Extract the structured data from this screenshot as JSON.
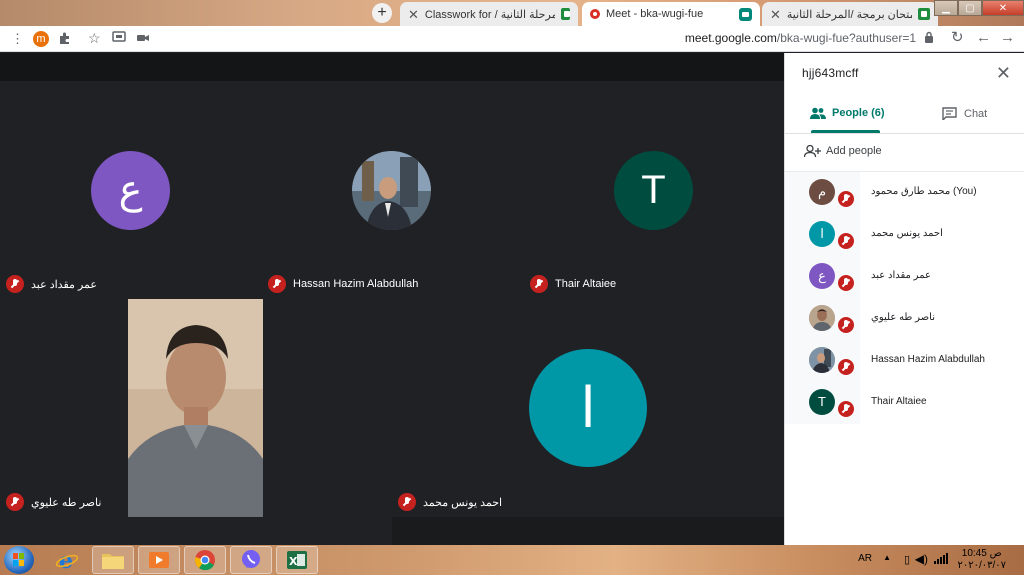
{
  "browser": {
    "tabs": [
      {
        "title": "امتحان برمجة /المرحلة الثانية /"
      },
      {
        "title": "Meet - bka-wugi-fue"
      },
      {
        "title": "Classwork for / برمجة /المرحلة الثانية"
      }
    ],
    "profile_initial": "m",
    "url_host": "meet.google.com",
    "url_path": "/bka-wugi-fue?authuser=1"
  },
  "stage": {
    "tiles": [
      {
        "name": "عمر مقداد عبد",
        "avatar_letter": "ع",
        "avatar_color": "#7e57c2"
      },
      {
        "name": "Hassan Hazim Alabdullah"
      },
      {
        "name": "Thair Altaiee",
        "avatar_letter": "T",
        "avatar_color": "#004d40"
      },
      {
        "name": "ناصر طه عليوي"
      },
      {
        "name": "احمد يونس محمد",
        "avatar_letter": "ا",
        "avatar_color": "#0097a7"
      }
    ]
  },
  "panel": {
    "meeting_code": "hjj643mcff",
    "tab_people": "People (6)",
    "tab_chat": "Chat",
    "add_people": "Add people",
    "participants": [
      {
        "name": "محمد طارق محمود (You)",
        "avatar_letter": "م",
        "avatar_color": "#6d4c41"
      },
      {
        "name": "احمد يونس محمد",
        "avatar_letter": "ا",
        "avatar_color": "#0097a7"
      },
      {
        "name": "عمر مقداد عبد",
        "avatar_letter": "ع",
        "avatar_color": "#7e57c2"
      },
      {
        "name": "ناصر طه عليوي",
        "avatar_letter": "",
        "avatar_color": "#9e9e9e"
      },
      {
        "name": "Hassan Hazim Alabdullah",
        "avatar_letter": "",
        "avatar_color": "#8d8d8d"
      },
      {
        "name": "Thair Altaiee",
        "avatar_letter": "T",
        "avatar_color": "#004d40"
      }
    ]
  },
  "taskbar": {
    "lang": "AR",
    "time": "ص 10:45",
    "date": "٢٠٢٠/٠٣/٠٧"
  }
}
